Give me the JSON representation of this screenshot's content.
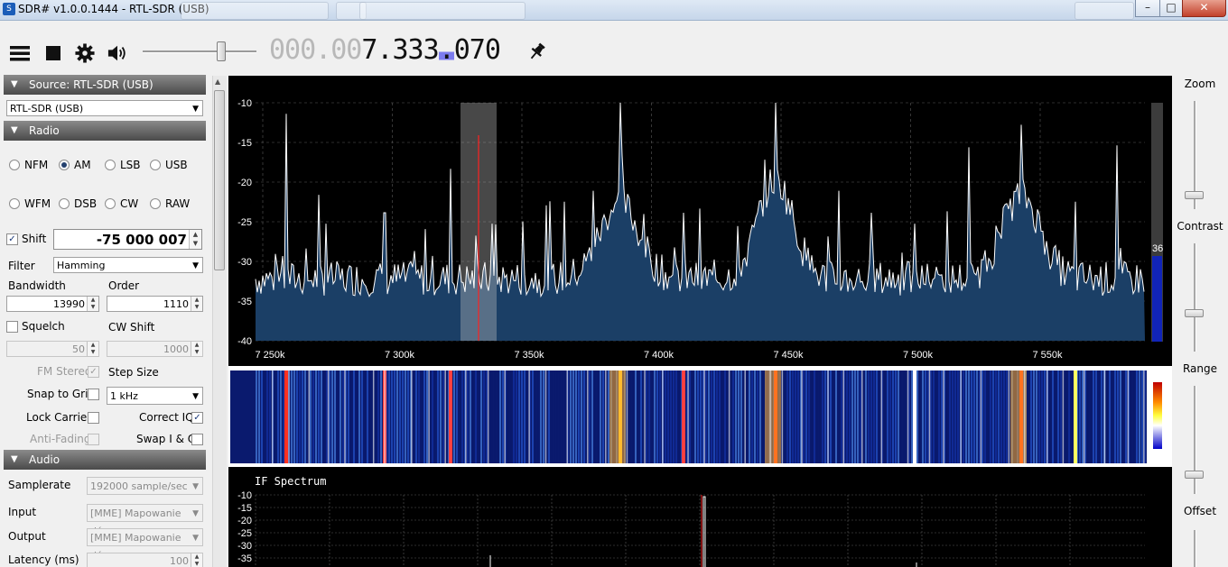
{
  "window": {
    "title": "SDR# v1.0.0.1444 - RTL-SDR (USB)",
    "ghost_tabs": [
      "",
      "",
      "",
      ""
    ],
    "minimize": "–",
    "maximize": "□",
    "close": "✕"
  },
  "toolbar": {
    "menu_icon": "hamburger-icon",
    "stop_icon": "stop-icon",
    "settings_icon": "gear-icon",
    "audio_icon": "speaker-icon",
    "pin_icon": "pin-icon",
    "volume_level": 0.69,
    "frequency": {
      "dim": "000.00",
      "bright1": "7.333",
      "highlight": ".",
      "bright2": "070"
    }
  },
  "source": {
    "header": "Source: RTL-SDR (USB)",
    "device": "RTL-SDR (USB)"
  },
  "radio": {
    "header": "Radio",
    "modes": [
      {
        "label": "NFM",
        "selected": false
      },
      {
        "label": "AM",
        "selected": true
      },
      {
        "label": "LSB",
        "selected": false
      },
      {
        "label": "USB",
        "selected": false
      },
      {
        "label": "WFM",
        "selected": false
      },
      {
        "label": "DSB",
        "selected": false
      },
      {
        "label": "CW",
        "selected": false
      },
      {
        "label": "RAW",
        "selected": false
      }
    ],
    "shift_label": "Shift",
    "shift_checked": true,
    "shift_value": "-75 000 007",
    "filter_label": "Filter",
    "filter_value": "Hamming",
    "bandwidth_label": "Bandwidth",
    "bandwidth_value": "13990",
    "order_label": "Order",
    "order_value": "1110",
    "squelch_label": "Squelch",
    "squelch_value": "50",
    "cwshift_label": "CW Shift",
    "cwshift_value": "1000",
    "fmstereo_label": "FM Stereo",
    "stepsize_label": "Step Size",
    "snap_label": "Snap to Grid",
    "stepsize_value": "1 kHz",
    "lockcarrier_label": "Lock Carrier",
    "correctiq_label": "Correct IQ",
    "antifading_label": "Anti-Fading",
    "swapiq_label": "Swap I & Q",
    "check_mark": "✓"
  },
  "audio": {
    "header": "Audio",
    "samplerate_label": "Samplerate",
    "samplerate_value": "192000 sample/sec",
    "input_label": "Input",
    "input_value": "[MME] Mapowanie dźw",
    "output_label": "Output",
    "output_value": "[MME] Mapowanie dźw",
    "latency_label": "Latency (ms)",
    "latency_value": "100"
  },
  "sidebar": {
    "zoom_label": "Zoom",
    "contrast_label": "Contrast",
    "range_label": "Range",
    "offset_label": "Offset"
  },
  "spectrum": {
    "y_ticks": [
      "-10",
      "-15",
      "-20",
      "-25",
      "-30",
      "-35",
      "-40"
    ],
    "x_ticks": [
      "7 250k",
      "7 300k",
      "7 350k",
      "7 400k",
      "7 450k",
      "7 500k",
      "7 550k"
    ],
    "level_value": "36",
    "colors": {
      "fill": "#1b3f66",
      "line": "#ffffff",
      "grid": "#5a5a5a",
      "tuned": "#ff2020"
    }
  },
  "if_spectrum": {
    "title": "IF Spectrum",
    "y_ticks": [
      "-10",
      "-15",
      "-20",
      "-25",
      "-30",
      "-35"
    ]
  },
  "icons": {
    "triangle": "▼",
    "combo_arrow": "▼",
    "spin": "▲▼"
  }
}
